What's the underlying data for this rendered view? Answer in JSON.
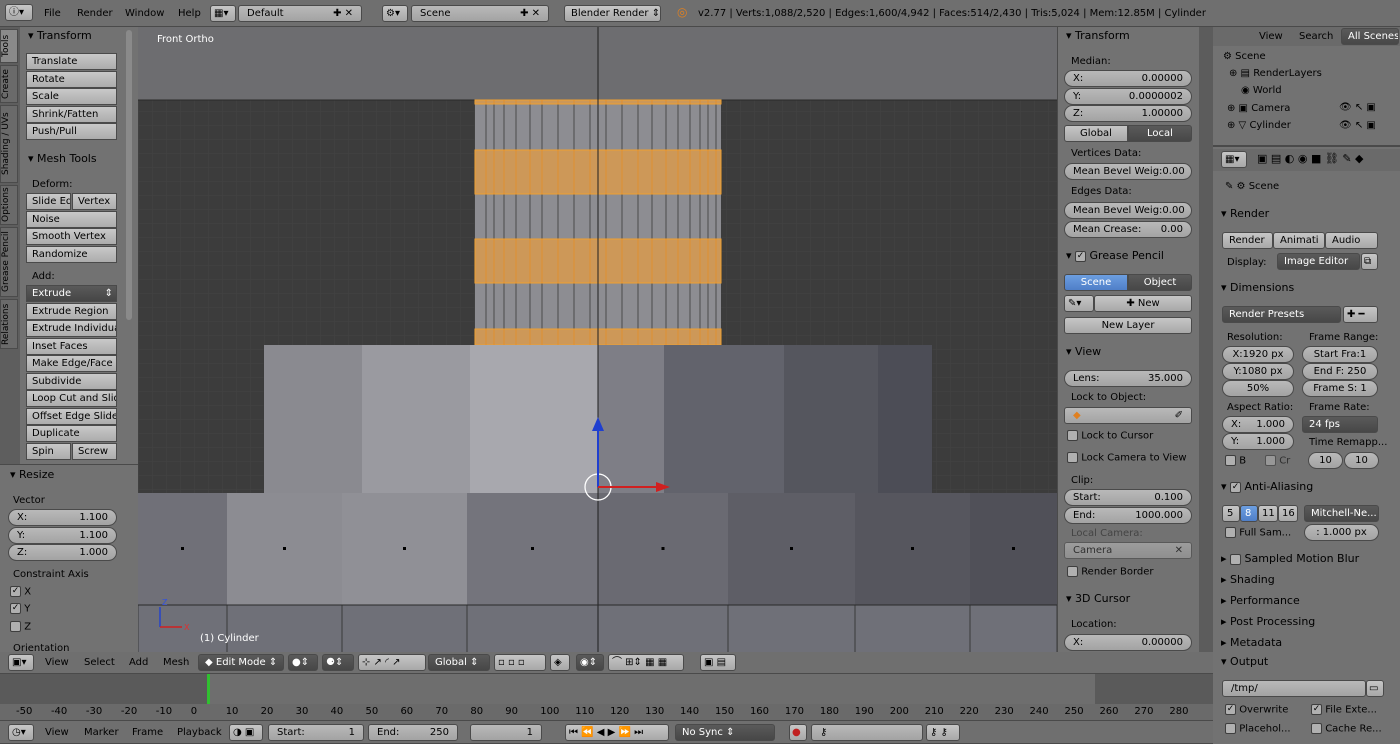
{
  "topbar": {
    "menus": [
      "File",
      "Render",
      "Window",
      "Help"
    ],
    "layout": "Default",
    "scene": "Scene",
    "engine": "Blender Render",
    "stats": "v2.77 | Verts:1,088/2,520 | Edges:1,600/4,942 | Faces:514/2,430 | Tris:5,024 | Mem:12.85M | Cylinder"
  },
  "tool_tabs": [
    "Tools",
    "Create",
    "Shading / UVs",
    "Options",
    "Grease Pencil",
    "Relations"
  ],
  "tools": {
    "transform_title": "Transform",
    "transform": [
      "Translate",
      "Rotate",
      "Scale",
      "Shrink/Fatten",
      "Push/Pull"
    ],
    "meshtools_title": "Mesh Tools",
    "deform_label": "Deform:",
    "slide_edge": "Slide Ed",
    "vertex": "Vertex",
    "noise": "Noise",
    "smooth_vertex": "Smooth Vertex",
    "randomize": "Randomize",
    "add_label": "Add:",
    "extrude": "Extrude",
    "add_items": [
      "Extrude Region",
      "Extrude Individual",
      "Inset Faces",
      "Make Edge/Face",
      "Subdivide",
      "Loop Cut and Slide",
      "Offset Edge Slide",
      "Duplicate"
    ],
    "spin": "Spin",
    "screw": "Screw"
  },
  "resize": {
    "title": "Resize",
    "vector_label": "Vector",
    "x": "X:",
    "xv": "1.100",
    "y": "Y:",
    "yv": "1.100",
    "z": "Z:",
    "zv": "1.000",
    "constraint_label": "Constraint Axis",
    "cx": "X",
    "cy": "Y",
    "cz": "Z",
    "orientation": "Orientation"
  },
  "viewport": {
    "label": "Front Ortho",
    "object_label": "(1) Cylinder",
    "axis_x": "X",
    "axis_z": "Z"
  },
  "props": {
    "transform_title": "Transform",
    "median": "Median:",
    "x": "X:",
    "xv": "0.00000",
    "y": "Y:",
    "yv": "0.0000002",
    "z": "Z:",
    "zv": "1.00000",
    "global": "Global",
    "local": "Local",
    "vdata": "Vertices Data:",
    "mbw": "Mean Bevel Weig:",
    "mbwv": "0.00",
    "edata": "Edges Data:",
    "mbw2": "Mean Bevel Weig:",
    "mbw2v": "0.00",
    "mcrease": "Mean Crease:",
    "mcreasev": "0.00",
    "gp_title": "Grease Pencil",
    "gp_scene": "Scene",
    "gp_object": "Object",
    "gp_new": "New",
    "gp_newlayer": "New Layer",
    "view_title": "View",
    "lens": "Lens:",
    "lensv": "35.000",
    "lock_obj": "Lock to Object:",
    "lock_cursor": "Lock to Cursor",
    "lock_cam": "Lock Camera to View",
    "clip": "Clip:",
    "start": "Start:",
    "startv": "0.100",
    "end": "End:",
    "endv": "1000.000",
    "local_camera": "Local Camera:",
    "camera": "Camera",
    "render_border": "Render Border",
    "cursor_title": "3D Cursor",
    "location": "Location:",
    "cx": "X:",
    "cxv": "0.00000"
  },
  "outliner": {
    "view": "View",
    "search": "Search",
    "all_scenes": "All Scenes",
    "items": [
      "Scene",
      "RenderLayers",
      "World",
      "Camera",
      "Cylinder"
    ]
  },
  "render": {
    "scene": "Scene",
    "render_title": "Render",
    "b_render": "Render",
    "b_anim": "Animati",
    "b_audio": "Audio",
    "display": "Display:",
    "display_v": "Image Editor",
    "dim_title": "Dimensions",
    "presets": "Render Presets",
    "resolution": "Resolution:",
    "frame_range": "Frame Range:",
    "resx": "X:1920 px",
    "resy": "Y:1080 px",
    "pct": "50%",
    "startf": "Start Fra:1",
    "endf": "End F: 250",
    "framestep": "Frame S: 1",
    "aspect": "Aspect Ratio:",
    "framerate": "Frame Rate:",
    "ax": "X:",
    "axv": "1.000",
    "ay": "Y:",
    "ayv": "1.000",
    "fps": "24 fps",
    "timeremap": "Time Remapp...",
    "b": "B",
    "cr": "Cr",
    "tr1": "10",
    "tr2": "10",
    "aa_title": "Anti-Aliasing",
    "aa": [
      "5",
      "8",
      "11",
      "16"
    ],
    "filter": "Mitchell-Ne...",
    "fullsample": "Full Sam...",
    "filtersize": ": 1.000 px",
    "motionblur": "Sampled Motion Blur",
    "shading": "Shading",
    "performance": "Performance",
    "postproc": "Post Processing",
    "metadata": "Metadata",
    "output": "Output",
    "path": "/tmp/",
    "overwrite": "Overwrite",
    "fileext": "File Exte...",
    "placeholder": "Placehol...",
    "cacheres": "Cache Re..."
  },
  "viewheader": {
    "view": "View",
    "select": "Select",
    "add": "Add",
    "mesh": "Mesh",
    "mode": "Edit Mode",
    "orientation": "Global"
  },
  "timeline": {
    "ticks": [
      "-50",
      "-40",
      "-30",
      "-20",
      "-10",
      "0",
      "10",
      "20",
      "30",
      "40",
      "50",
      "60",
      "70",
      "80",
      "90",
      "100",
      "110",
      "120",
      "130",
      "140",
      "150",
      "160",
      "170",
      "180",
      "190",
      "200",
      "210",
      "220",
      "230",
      "240",
      "250",
      "260",
      "270",
      "280"
    ],
    "view": "View",
    "marker": "Marker",
    "frame": "Frame",
    "playback": "Playback",
    "start": "Start:",
    "startv": "1",
    "end": "End:",
    "endv": "250",
    "current": "1",
    "sync": "No Sync"
  }
}
